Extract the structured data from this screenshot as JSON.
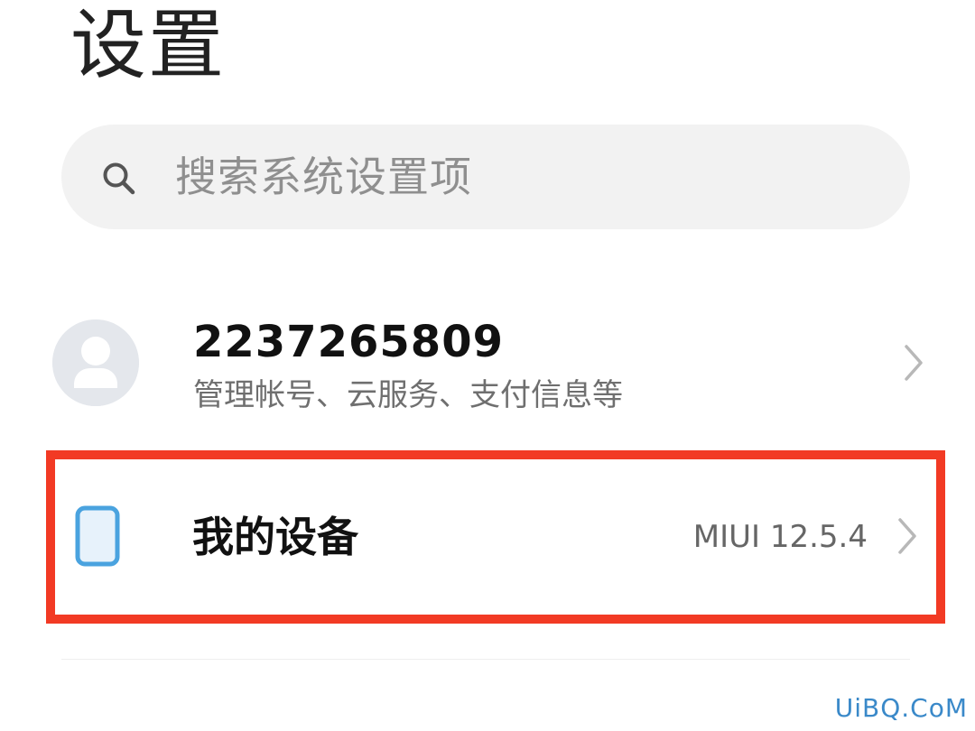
{
  "page": {
    "title": "设置"
  },
  "search": {
    "placeholder": "搜索系统设置项",
    "icon": "search-icon"
  },
  "account": {
    "id": "2237265809",
    "subtitle": "管理帐号、云服务、支付信息等",
    "avatar_icon": "user-avatar-icon",
    "chevron_icon": "chevron-right-icon"
  },
  "device": {
    "title": "我的设备",
    "value": "MIUI 12.5.4",
    "icon": "phone-outline-icon",
    "chevron_icon": "chevron-right-icon"
  },
  "colors": {
    "highlight_border": "#f23a24",
    "device_icon_stroke": "#4aa3df",
    "device_icon_fill": "#e7f2fb",
    "watermark": "#3a89c9"
  },
  "watermark": {
    "text": "UiBQ.CoM"
  }
}
